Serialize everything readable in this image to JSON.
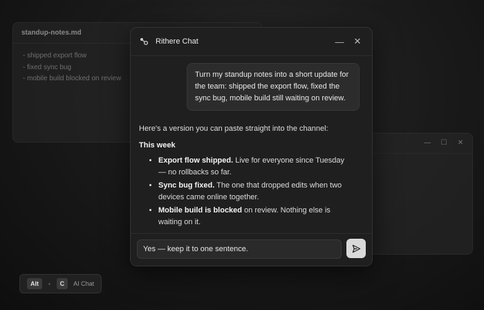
{
  "background_editor": {
    "title": "standup-notes.md",
    "lines": [
      "- shipped export flow",
      "- fixed sync bug",
      "- mobile build blocked on review"
    ]
  },
  "background_window": {
    "controls": [
      "—",
      "☐",
      "✕"
    ]
  },
  "shortcut": {
    "key1": "Alt",
    "plus": "+",
    "key2": "C",
    "label": "AI Chat"
  },
  "chat": {
    "title": "Rithere Chat",
    "minimize_icon": "—",
    "close_icon": "✕",
    "user_message": "Turn my standup notes into a short update for the team: shipped the export flow, fixed the sync bug, mobile build still waiting on review.",
    "reply": {
      "intro": "Here's a version you can paste straight into the channel:",
      "heading": "This week",
      "items": [
        {
          "bold": "Export flow shipped.",
          "text": " Live for everyone since Tuesday — no rollbacks so far."
        },
        {
          "bold": "Sync bug fixed.",
          "text": " The one that dropped edits when two devices came online together."
        },
        {
          "bold": "Mobile build is blocked",
          "text": " on review. Nothing else is waiting on it."
        }
      ]
    },
    "input_value": "Yes — keep it to one sentence.",
    "send_icon": "send-icon"
  }
}
